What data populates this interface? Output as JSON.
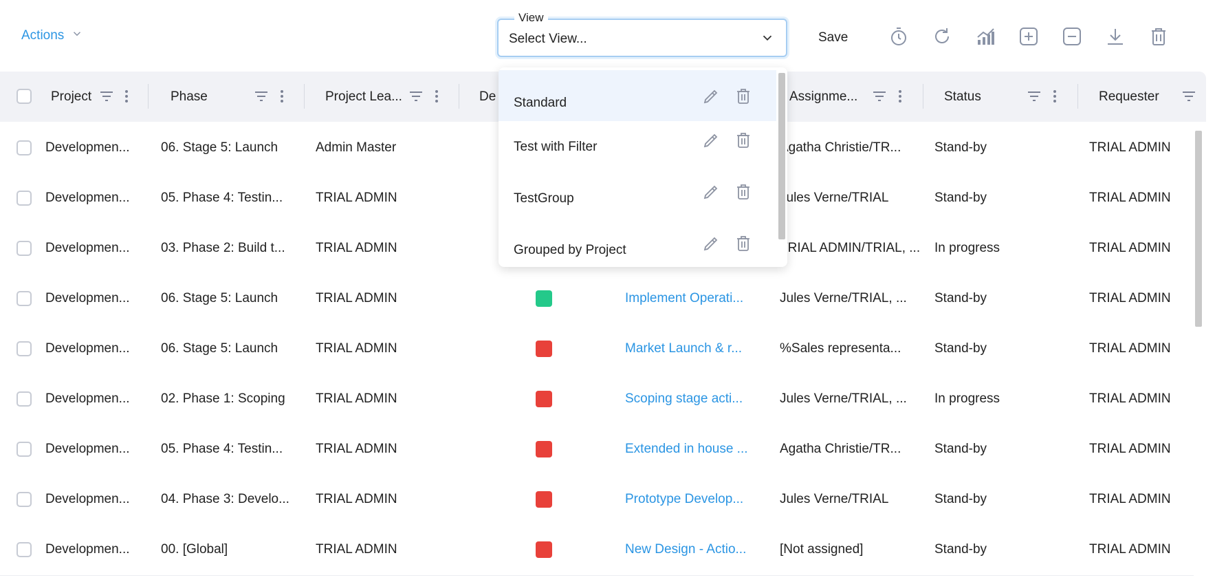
{
  "toolbar": {
    "actions_label": "Actions",
    "view_label": "View",
    "view_value": "Select View...",
    "save_label": "Save",
    "icons": [
      "timer-icon",
      "refresh-icon",
      "chart-icon",
      "add-square-icon",
      "remove-square-icon",
      "download-icon",
      "trash-icon"
    ]
  },
  "grid": {
    "columns": [
      "Project",
      "Phase",
      "Project Lea...",
      "De",
      "Assignme...",
      "Status",
      "Requester"
    ],
    "rows": [
      {
        "project": "Developmen...",
        "phase": "06. Stage 5: Launch",
        "lead": "Admin Master",
        "color": "",
        "task": "",
        "assignee": "Agatha Christie/TR...",
        "status": "Stand-by",
        "requester": "TRIAL ADMIN"
      },
      {
        "project": "Developmen...",
        "phase": "05. Phase 4: Testin...",
        "lead": "TRIAL ADMIN",
        "color": "",
        "task": "",
        "assignee": "Jules Verne/TRIAL",
        "status": "Stand-by",
        "requester": "TRIAL ADMIN"
      },
      {
        "project": "Developmen...",
        "phase": "03. Phase 2: Build t...",
        "lead": "TRIAL ADMIN",
        "color": "",
        "task": "",
        "assignee": "TRIAL ADMIN/TRIAL, ...",
        "status": "In progress",
        "requester": "TRIAL ADMIN"
      },
      {
        "project": "Developmen...",
        "phase": "06. Stage 5: Launch",
        "lead": "TRIAL ADMIN",
        "color": "#24c98a",
        "task": "Implement Operati...",
        "assignee": "Jules Verne/TRIAL, ...",
        "status": "Stand-by",
        "requester": "TRIAL ADMIN"
      },
      {
        "project": "Developmen...",
        "phase": "06. Stage 5: Launch",
        "lead": "TRIAL ADMIN",
        "color": "#e8413a",
        "task": "Market Launch & r...",
        "assignee": "%Sales representa...",
        "status": "Stand-by",
        "requester": "TRIAL ADMIN"
      },
      {
        "project": "Developmen...",
        "phase": "02. Phase 1: Scoping",
        "lead": "TRIAL ADMIN",
        "color": "#e8413a",
        "task": "Scoping stage acti...",
        "assignee": "Jules Verne/TRIAL, ...",
        "status": "In progress",
        "requester": "TRIAL ADMIN"
      },
      {
        "project": "Developmen...",
        "phase": "05. Phase 4: Testin...",
        "lead": "TRIAL ADMIN",
        "color": "#e8413a",
        "task": "Extended in house ...",
        "assignee": "Agatha Christie/TR...",
        "status": "Stand-by",
        "requester": "TRIAL ADMIN"
      },
      {
        "project": "Developmen...",
        "phase": "04. Phase 3: Develo...",
        "lead": "TRIAL ADMIN",
        "color": "#e8413a",
        "task": "Prototype Develop...",
        "assignee": "Jules Verne/TRIAL",
        "status": "Stand-by",
        "requester": "TRIAL ADMIN"
      },
      {
        "project": "Developmen...",
        "phase": "00. [Global]",
        "lead": "TRIAL ADMIN",
        "color": "#e8413a",
        "task": "New Design - Actio...",
        "assignee": "[Not assigned]",
        "status": "Stand-by",
        "requester": "TRIAL ADMIN"
      }
    ]
  },
  "dropdown": {
    "items": [
      "Standard",
      "Test with Filter",
      "TestGroup",
      "Grouped by Project"
    ]
  },
  "colors": {
    "accent": "#2b95e3",
    "header_bg": "#f1f2f6",
    "green": "#24c98a",
    "red": "#e8413a"
  }
}
